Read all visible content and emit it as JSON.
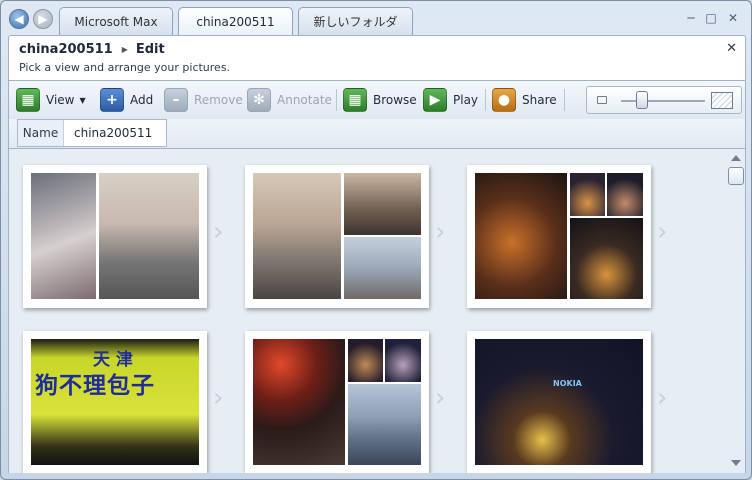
{
  "tabs": [
    {
      "label": "Microsoft Max"
    },
    {
      "label": "china200511"
    },
    {
      "label": "新しいフォルダ"
    }
  ],
  "header": {
    "folder": "china200511",
    "mode": "Edit",
    "subtitle": "Pick a view and arrange your pictures."
  },
  "toolbar": {
    "view_label": "View",
    "add_label": "Add",
    "remove_label": "Remove",
    "annotate_label": "Annotate",
    "browse_label": "Browse",
    "play_label": "Play",
    "share_label": "Share"
  },
  "zoom": {
    "level": 0.25
  },
  "name_field": {
    "label": "Name",
    "value": "china200511"
  },
  "signs": {
    "line1": "天 津",
    "line2": "狗不理包子",
    "neon": "NOKIA"
  },
  "colors": {
    "accent": "#3c6ea8",
    "green": "#2d7d2b",
    "orange": "#b86e13"
  },
  "icons": {
    "back": "back-arrow-icon",
    "forward": "forward-arrow-icon",
    "view": "view-layout-icon",
    "add": "plus-icon",
    "remove": "minus-icon",
    "annotate": "annotate-icon",
    "browse": "browse-grid-icon",
    "play": "play-icon",
    "share": "share-lock-icon"
  }
}
